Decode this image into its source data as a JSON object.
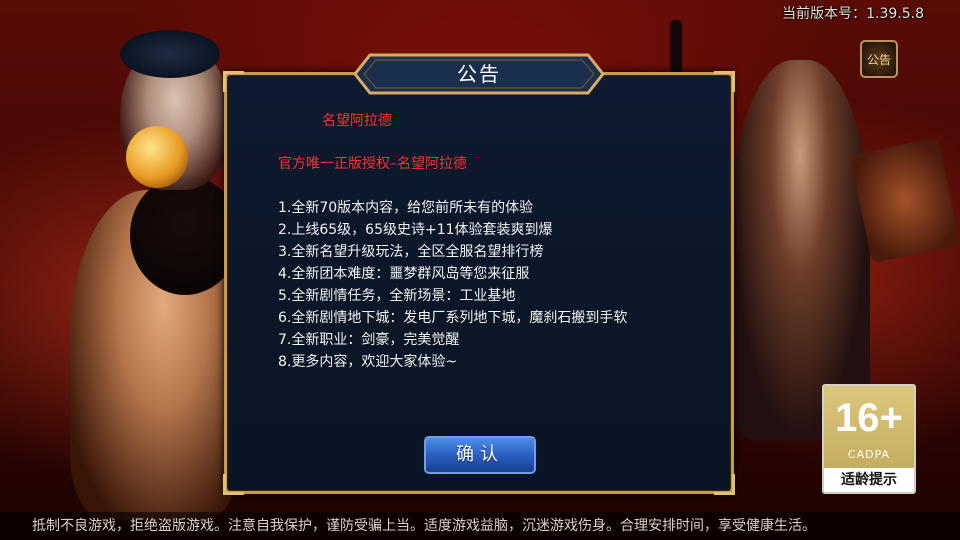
{
  "header": {
    "version_text": "当前版本号：1.39.5.8",
    "notice_button_label": "公告"
  },
  "dialog": {
    "title": "公告",
    "headline": "名望阿拉德",
    "subheadline": "官方唯一正版授权–名望阿拉德",
    "items": [
      "1.全新70版本内容，给您前所未有的体验",
      "2.上线65级，65级史诗+11体验套装爽到爆",
      "3.全新名望升级玩法，全区全服名望排行榜",
      "4.全新团本难度：噩梦群风岛等您来征服",
      "5.全新剧情任务，全新场景：工业基地",
      "6.全新剧情地下城：发电厂系列地下城，魔刹石搬到手软",
      "7.全新职业：剑豪，完美觉醒",
      "8.更多内容，欢迎大家体验~"
    ],
    "confirm_label": "确认"
  },
  "age_rating": {
    "rating": "16+",
    "org": "CADPA",
    "caption": "适龄提示"
  },
  "footer": {
    "text": "抵制不良游戏，拒绝盗版游戏。注意自我保护，谨防受骗上当。适度游戏益脑，沉迷游戏伤身。合理安排时间，享受健康生活。"
  },
  "colors": {
    "accent_red": "#ff3030",
    "dialog_bg": "#0b1628",
    "gold_border": "#c79b4e",
    "button_blue": "#2a5fc2"
  }
}
